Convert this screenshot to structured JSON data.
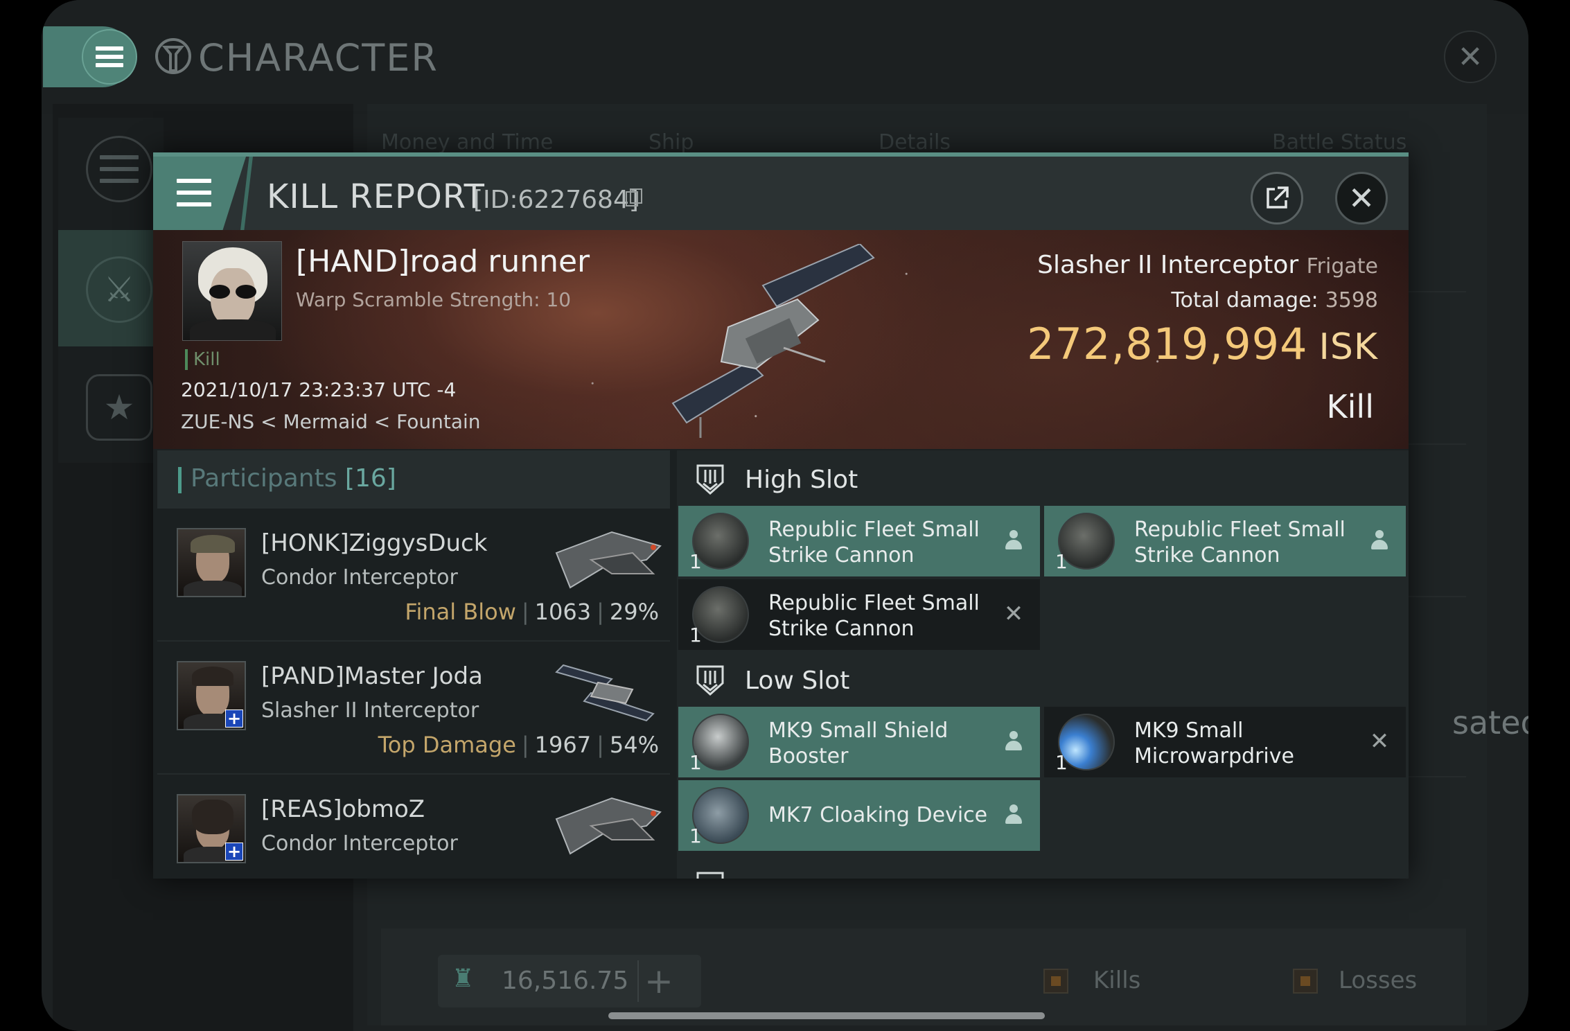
{
  "background": {
    "title": "CHARACTER",
    "columns": [
      "Money and Time",
      "Ship",
      "Details",
      "Battle Status"
    ],
    "partial_text": "sated",
    "isk_balance": "16,516.75",
    "legend": [
      "Kills",
      "Losses"
    ]
  },
  "report": {
    "title": "KILL REPORT",
    "id": "[ID:6227684]",
    "victim": {
      "name": "[HAND]road runner",
      "warp_scramble": "Warp Scramble Strength: 10",
      "tag": "Kill",
      "time": "2021/10/17 23:23:37 UTC -4",
      "location": "ZUE-NS < Mermaid < Fountain"
    },
    "ship": {
      "name": "Slasher II Interceptor",
      "class": "Frigate",
      "total_damage_label": "Total damage:",
      "total_damage": "3598",
      "isk_value": "272,819,994",
      "isk_unit": "ISK",
      "result": "Kill"
    },
    "participants": {
      "label": "Participants",
      "count": "[16]",
      "rows": [
        {
          "name": "[HONK]ZiggysDuck",
          "ship": "Condor Interceptor",
          "stat_label": "Final Blow",
          "damage": "1063",
          "percent": "29%"
        },
        {
          "name": "[PAND]Master Joda",
          "ship": "Slasher II Interceptor",
          "stat_label": "Top Damage",
          "damage": "1967",
          "percent": "54%"
        },
        {
          "name": "[REAS]obmoZ",
          "ship": "Condor Interceptor",
          "stat_label": "",
          "damage": "",
          "percent": ""
        }
      ]
    },
    "fitting": {
      "high_slot": {
        "title": "High Slot",
        "modules": [
          {
            "name": "Republic Fleet Small Strike Cannon",
            "qty": "1",
            "state": "fitted",
            "state_icon": "person-icon"
          },
          {
            "name": "Republic Fleet Small Strike Cannon",
            "qty": "1",
            "state": "fitted",
            "state_icon": "person-icon"
          },
          {
            "name": "Republic Fleet Small Strike Cannon",
            "qty": "1",
            "state": "destroyed",
            "state_icon": "close-icon",
            "state_glyph": "✕"
          }
        ]
      },
      "low_slot": {
        "title": "Low Slot",
        "modules": [
          {
            "name": "MK9 Small Shield Booster",
            "qty": "1",
            "state": "fitted",
            "state_icon": "person-icon"
          },
          {
            "name": "MK9 Small Microwarpdrive",
            "qty": "1",
            "state": "destroyed",
            "state_icon": "close-icon",
            "state_glyph": "✕"
          },
          {
            "name": "MK7 Cloaking Device",
            "qty": "1",
            "state": "fitted",
            "state_icon": "person-icon"
          }
        ]
      }
    }
  }
}
